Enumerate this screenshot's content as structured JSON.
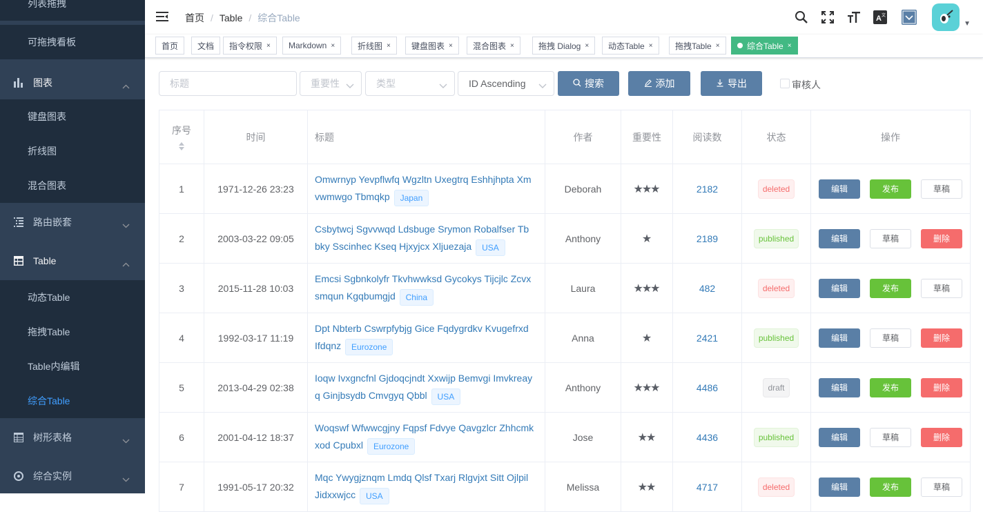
{
  "sidebar": {
    "items": [
      {
        "label": "列表拖拽",
        "type": "sub"
      },
      {
        "label": "可拖拽看板",
        "type": "sub"
      },
      {
        "label": "图表",
        "type": "top",
        "icon": "chart-icon",
        "open": true
      },
      {
        "label": "键盘图表",
        "type": "sub"
      },
      {
        "label": "折线图",
        "type": "sub"
      },
      {
        "label": "混合图表",
        "type": "sub"
      },
      {
        "label": "路由嵌套",
        "type": "top",
        "icon": "nested-icon",
        "open": false
      },
      {
        "label": "Table",
        "type": "top",
        "icon": "table-icon",
        "open": true
      },
      {
        "label": "动态Table",
        "type": "sub"
      },
      {
        "label": "拖拽Table",
        "type": "sub"
      },
      {
        "label": "Table内编辑",
        "type": "sub"
      },
      {
        "label": "综合Table",
        "type": "sub",
        "active": true
      },
      {
        "label": "树形表格",
        "type": "top",
        "icon": "tree-table-icon",
        "open": false
      },
      {
        "label": "综合实例",
        "type": "top",
        "icon": "example-icon",
        "open": false
      }
    ]
  },
  "navbar": {
    "breadcrumb": [
      "首页",
      "Table",
      "综合Table"
    ]
  },
  "tags": [
    {
      "label": "首页",
      "closable": false
    },
    {
      "label": "文档",
      "closable": false
    },
    {
      "label": "指令权限",
      "closable": true
    },
    {
      "label": "Markdown",
      "closable": true
    },
    {
      "label": "折线图",
      "closable": true
    },
    {
      "label": "键盘图表",
      "closable": true
    },
    {
      "label": "混合图表",
      "closable": true
    },
    {
      "label": "拖拽 Dialog",
      "closable": true
    },
    {
      "label": "动态Table",
      "closable": true
    },
    {
      "label": "拖拽Table",
      "closable": true
    },
    {
      "label": "综合Table",
      "closable": true,
      "active": true
    }
  ],
  "filter": {
    "title_placeholder": "标题",
    "importance_placeholder": "重要性",
    "type_placeholder": "类型",
    "sort_value": "ID Ascending",
    "search_label": "搜索",
    "add_label": "添加",
    "export_label": "导出",
    "reviewer_label": "审核人"
  },
  "table": {
    "headers": [
      "序号",
      "时间",
      "标题",
      "作者",
      "重要性",
      "阅读数",
      "状态",
      "操作"
    ],
    "rows": [
      {
        "id": "1",
        "time": "1971-12-26 23:23",
        "title": "Omwrnyp Yevpflwfq Wgzltn Uxegtrq Eshhjhpta Xm vwmwgo Tbmqkp",
        "region": "Japan",
        "author": "Deborah",
        "importance": 3,
        "reads": "2182",
        "status": "deleted",
        "actions": [
          "编辑",
          "发布",
          "草稿"
        ]
      },
      {
        "id": "2",
        "time": "2003-03-22 09:05",
        "title": "Csbytwcj Sgvvwqd Ldsbuge Srymon Robalfser Tb bky Sscinhec Kseq Hjxyjcx Xljuezaja",
        "region": "USA",
        "author": "Anthony",
        "importance": 1,
        "reads": "2189",
        "status": "published",
        "actions": [
          "编辑",
          "草稿",
          "删除"
        ]
      },
      {
        "id": "3",
        "time": "2015-11-28 10:03",
        "title": "Emcsi Sgbnkolyfr Tkvhwwksd Gycokys Tijcjlc Zcvx smqun Kgqbumgjd",
        "region": "China",
        "author": "Laura",
        "importance": 3,
        "reads": "482",
        "status": "deleted",
        "actions": [
          "编辑",
          "发布",
          "草稿"
        ]
      },
      {
        "id": "4",
        "time": "1992-03-17 11:19",
        "title": "Dpt Nbterb Cswrpfybjg Gice Fqdygrdkv Kvugefrxd Ifdqnz",
        "region": "Eurozone",
        "author": "Anna",
        "importance": 1,
        "reads": "2421",
        "status": "published",
        "actions": [
          "编辑",
          "草稿",
          "删除"
        ]
      },
      {
        "id": "5",
        "time": "2013-04-29 02:38",
        "title": "Ioqw Ivxgncfnl Gjdoqcjndt Xxwijp Bemvgi Imvkreay q Ginjbsydb Cmvgyq Qbbl",
        "region": "USA",
        "author": "Anthony",
        "importance": 3,
        "reads": "4486",
        "status": "draft",
        "actions": [
          "编辑",
          "发布",
          "删除"
        ]
      },
      {
        "id": "6",
        "time": "2001-04-12 18:37",
        "title": "Woqswf Wfwwcgjny Fqpsf Fdvye Qavgzlcr Zhhcmk xod Cpubxl",
        "region": "Eurozone",
        "author": "Jose",
        "importance": 2,
        "reads": "4436",
        "status": "published",
        "actions": [
          "编辑",
          "草稿",
          "删除"
        ]
      },
      {
        "id": "7",
        "time": "1991-05-17 20:32",
        "title": "Mqc Ywygjznqm Lmdq Qlsf Txarj Rlgvjxt Sitt Ojlpil Jidxxwjcc",
        "region": "USA",
        "author": "Melissa",
        "importance": 2,
        "reads": "4717",
        "status": "deleted",
        "actions": [
          "编辑",
          "发布",
          "草稿"
        ]
      }
    ]
  }
}
